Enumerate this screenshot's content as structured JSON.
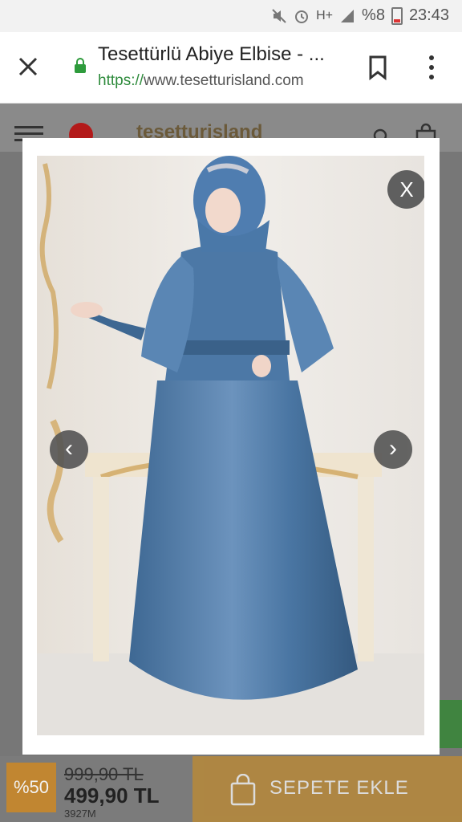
{
  "status_bar": {
    "icons": [
      "mute-icon",
      "alarm-icon",
      "hplus-signal-icon",
      "signal-icon",
      "battery-icon"
    ],
    "network": "H+",
    "battery": "%8",
    "time": "23:43"
  },
  "browser": {
    "page_title": "Tesettürlü Abiye Elbise - ...",
    "url_scheme": "https://",
    "url_host": "www.tesetturisland.com"
  },
  "site": {
    "logo_text": "tesetturisland"
  },
  "modal": {
    "close_label": "X",
    "prev_label": "‹",
    "next_label": "›"
  },
  "product": {
    "discount_badge": "%50",
    "old_price": "999,90 TL",
    "new_price": "499,90 TL",
    "code": "3927M",
    "add_to_cart_label": "SEPETE EKLE"
  },
  "colors": {
    "url_scheme": "#2e8b3c",
    "lock": "#2e9b3c",
    "dress": "#4f7aa8",
    "cart_button": "#b7893a"
  }
}
